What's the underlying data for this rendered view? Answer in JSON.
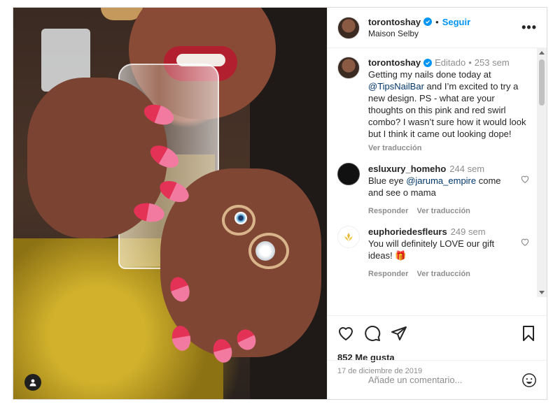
{
  "post": {
    "username": "torontoshay",
    "follow_label": "Seguir",
    "location": "Maison Selby",
    "more_label": "•••"
  },
  "caption": {
    "username": "torontoshay",
    "edited_label": "Editado",
    "time": "253 sem",
    "text_before": "Getting my nails done today at",
    "mention": "@TipsNailBar",
    "text_after": "and I’m excited to try a new design. PS - what are your thoughts on this pink and red swirl combo? I wasn’t sure how it would look but I think it came out looking dope!",
    "translate_label": "Ver traducción"
  },
  "comments": [
    {
      "username": "esluxury_homeho",
      "time": "244 sem",
      "text_before": "Blue eye",
      "mention": "@jaruma_empire",
      "text_after": "come and see o mama",
      "reply_label": "Responder",
      "translate_label": "Ver traducción"
    },
    {
      "username": "euphoriedesfleurs",
      "time": "249 sem",
      "text": "You will definitely LOVE our gift ideas! 🎁",
      "reply_label": "Responder",
      "translate_label": "Ver traducción"
    }
  ],
  "stats": {
    "likes": "852 Me gusta",
    "date": "17 de diciembre de 2019"
  },
  "composer": {
    "placeholder": "Añade un comentario..."
  },
  "icons": {
    "verified": "verified-badge-icon",
    "like": "heart-icon",
    "comment": "comment-icon",
    "share": "paper-plane-icon",
    "save": "bookmark-icon",
    "emoji": "emoji-icon",
    "tag": "user-tag-icon"
  },
  "colors": {
    "accent": "#0095f6",
    "text": "#262626",
    "muted": "#8e8e8e",
    "mention": "#00376b"
  }
}
